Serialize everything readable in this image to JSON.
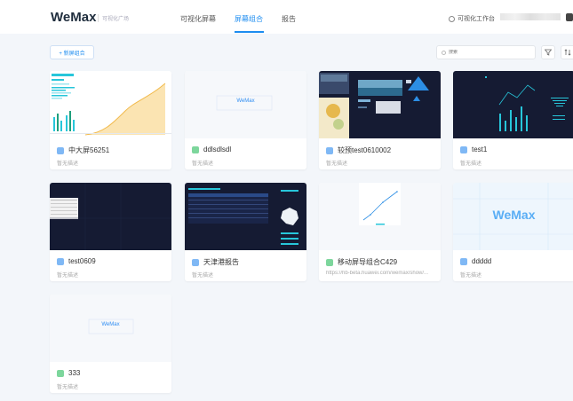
{
  "header": {
    "logo": "WeMax",
    "logo_sub": "可视化广场",
    "nav": [
      "可视化屏幕",
      "屏幕组合",
      "报告"
    ],
    "workspace": "可视化工作台"
  },
  "toolbar": {
    "new_label": "+ 新屏组合",
    "search_placeholder": "搜索"
  },
  "cards": [
    {
      "title": "中大屏56251",
      "desc": "暂无描述",
      "icon": "blue"
    },
    {
      "title": "ddlsdlsdl",
      "desc": "暂无描述",
      "icon": "green"
    },
    {
      "title": "较预test0610002",
      "desc": "暂无描述",
      "icon": "blue"
    },
    {
      "title": "test1",
      "desc": "暂无描述",
      "icon": "blue"
    },
    {
      "title": "test0609",
      "desc": "暂无描述",
      "icon": "blue"
    },
    {
      "title": "天津港报告",
      "desc": "暂无描述",
      "icon": "blue"
    },
    {
      "title": "移动屏导组合C429",
      "desc": "https://hb-beta.huawei.com/wemax/show/...",
      "icon": "green"
    },
    {
      "title": "ddddd",
      "desc": "暂无描述",
      "icon": "blue"
    },
    {
      "title": "333",
      "desc": "暂无描述",
      "icon": "green"
    }
  ],
  "thumb_logo_text": "WeMax",
  "colors": {
    "accent": "#1c8cf0",
    "dark_thumb": "#151b33",
    "cyan": "#27c6da"
  }
}
